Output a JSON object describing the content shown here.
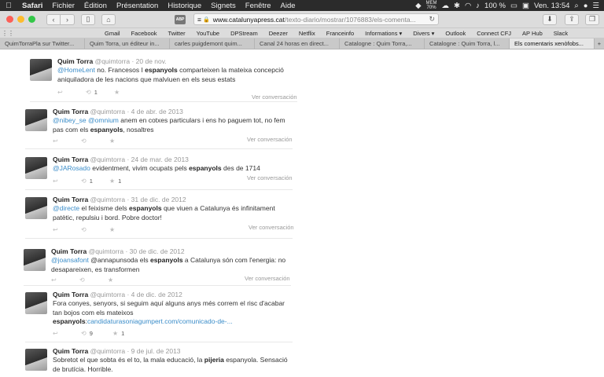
{
  "menubar": {
    "app": "Safari",
    "items": [
      "Fichier",
      "Édition",
      "Présentation",
      "Historique",
      "Signets",
      "Fenêtre",
      "Aide"
    ],
    "mem_label": "MEM",
    "mem_value": "70%",
    "battery": "100 %",
    "clock": "Ven. 13:54"
  },
  "toolbar": {
    "adblock_label": "ABP",
    "url_host": "www.catalunyapress.cat",
    "url_path": "/texto-diario/mostrar/1076883/els-comenta..."
  },
  "favorites": [
    "Gmail",
    "Facebook",
    "Twitter",
    "YouTube",
    "DPStream",
    "Deezer",
    "Netflix",
    "Franceinfo",
    "Informations ▾",
    "Divers ▾",
    "Outlook",
    "Connect CFJ",
    "AP Hub",
    "Slack"
  ],
  "tabs": [
    {
      "label": "QuimTorraPla sur Twitter...",
      "active": false
    },
    {
      "label": "Quim Torra, un éditeur in...",
      "active": false
    },
    {
      "label": "carles puigdemont quim...",
      "active": false
    },
    {
      "label": "Canal 24 horas en direct...",
      "active": false
    },
    {
      "label": "Catalogne : Quim Torra,...",
      "active": false
    },
    {
      "label": "Catalogne : Quim Torra, l...",
      "active": false
    },
    {
      "label": "Els comentaris xenòfobs...",
      "active": true
    }
  ],
  "tweets": [
    {
      "name": "Quim Torra",
      "handle": "@quimtorra",
      "date": "· 20 de nov.",
      "segments": [
        [
          "m",
          "@HomeLent"
        ],
        [
          "t",
          " no. Francesos I "
        ],
        [
          "b",
          "espanyols"
        ],
        [
          "t",
          " comparteixen la mateixa concepció aniquiladora de les nacions que malviuen en els seus estats"
        ]
      ],
      "retweets": "1",
      "favorites": "",
      "more": "Ver conversación"
    },
    {
      "name": "Quim Torra",
      "handle": "@quimtorra",
      "date": "· 4 de abr. de 2013",
      "segments": [
        [
          "m",
          "@nibey_se"
        ],
        [
          "t",
          " "
        ],
        [
          "m",
          "@omnium"
        ],
        [
          "t",
          " anem en cotxes particulars i ens ho paguem tot, no fem pas com els "
        ],
        [
          "b",
          "espanyols"
        ],
        [
          "t",
          ", nosaltres"
        ]
      ],
      "retweets": "",
      "favorites": "",
      "more": "Ver conversación"
    },
    {
      "name": "Quim Torra",
      "handle": "@quimtorra",
      "date": "· 24 de mar. de 2013",
      "segments": [
        [
          "m",
          "@JARosado"
        ],
        [
          "t",
          " evidentment, vivim ocupats pels "
        ],
        [
          "b",
          "espanyols"
        ],
        [
          "t",
          " des de 1714"
        ]
      ],
      "retweets": "1",
      "favorites": "1",
      "more": "Ver conversación"
    },
    {
      "name": "Quim Torra",
      "handle": "@quimtorra",
      "date": "· 31 de dic. de 2012",
      "segments": [
        [
          "m",
          "@directe"
        ],
        [
          "t",
          " el feixisme dels "
        ],
        [
          "b",
          "espanyols"
        ],
        [
          "t",
          " que viuen a Catalunya és infinitament patètic, repulsiu i bord. Pobre doctor!"
        ]
      ],
      "retweets": "",
      "favorites": "",
      "more": "Ver conversación"
    },
    {
      "name": "Quim Torra",
      "handle": "@quimtorra",
      "date": "· 30 de dic. de 2012",
      "segments": [
        [
          "m",
          "@joansafont"
        ],
        [
          "t",
          " @annapunsoda els "
        ],
        [
          "b",
          "espanyols"
        ],
        [
          "t",
          " a Catalunya són com l'energia: no desapareixen, es transformen"
        ]
      ],
      "retweets": "",
      "favorites": "",
      "more": "Ver conversación"
    },
    {
      "name": "Quim Torra",
      "handle": "@quimtorra",
      "date": "· 4 de dic. de 2012",
      "segments": [
        [
          "t",
          "Fora conyes, senyors, si seguim aquí alguns anys més correm el risc d'acabar tan bojos com els mateixos "
        ],
        [
          "b",
          "espanyols"
        ],
        [
          "t",
          ":"
        ],
        [
          "l",
          "candidaturasoniagumpert.com/comunicado-de-..."
        ]
      ],
      "retweets": "9",
      "favorites": "1",
      "more": ""
    },
    {
      "name": "Quim Torra",
      "handle": "@quimtorra",
      "date": "· 9 de jul. de 2013",
      "segments": [
        [
          "t",
          "Sobretot el que sobta és el to, la mala educació, la "
        ],
        [
          "b",
          "pijeria"
        ],
        [
          "t",
          " espanyola. Sensació de brutícia. Horrible."
        ]
      ],
      "retweets": "",
      "favorites": "",
      "more": ""
    }
  ]
}
